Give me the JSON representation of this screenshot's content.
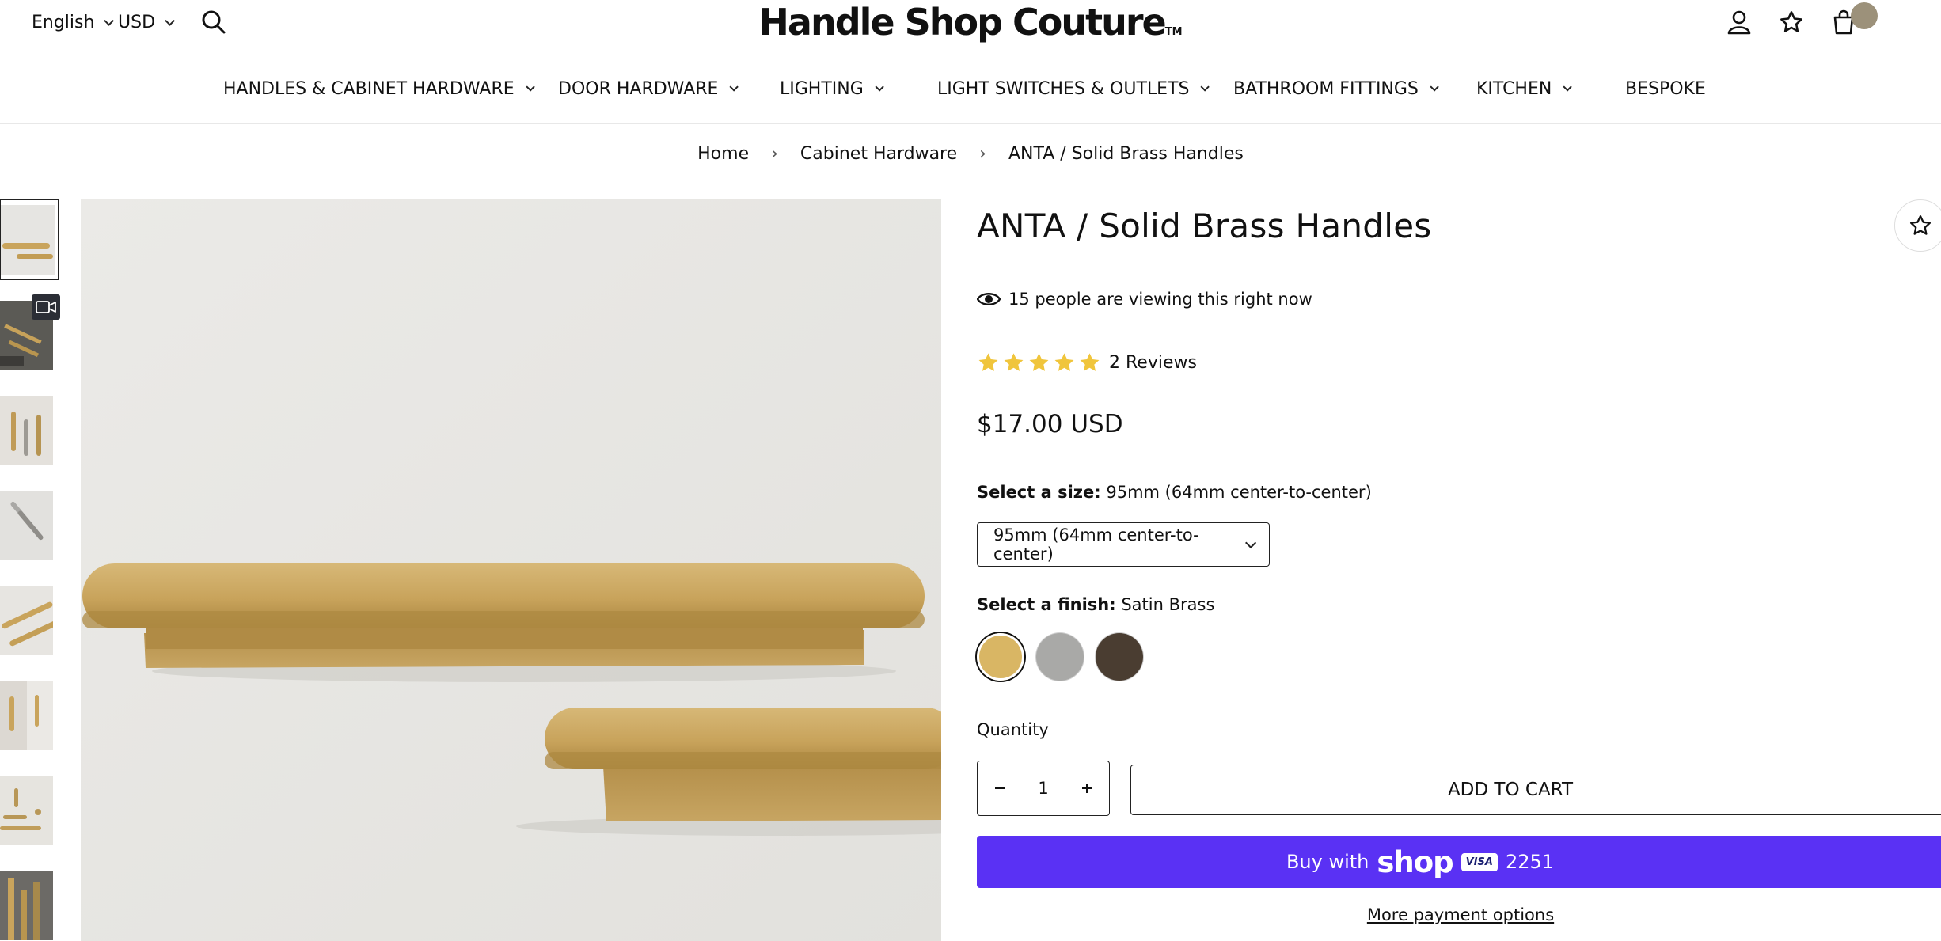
{
  "header": {
    "language": "English",
    "currency": "USD",
    "logo_text": "Handle Shop Couture",
    "logo_tm": "TM"
  },
  "nav": {
    "items": [
      {
        "label": "HANDLES & CABINET HARDWARE",
        "has_dropdown": true
      },
      {
        "label": "DOOR HARDWARE",
        "has_dropdown": true
      },
      {
        "label": "LIGHTING",
        "has_dropdown": true
      },
      {
        "label": "LIGHT SWITCHES & OUTLETS",
        "has_dropdown": true
      },
      {
        "label": "BATHROOM FITTINGS",
        "has_dropdown": true
      },
      {
        "label": "KITCHEN",
        "has_dropdown": true
      },
      {
        "label": "BESPOKE",
        "has_dropdown": false
      }
    ]
  },
  "breadcrumb": [
    "Home",
    "Cabinet Hardware",
    "ANTA / Solid Brass Handles"
  ],
  "product": {
    "title": "ANTA / Solid Brass Handles",
    "viewers_text": "15 people are viewing this right now",
    "rating_stars": 5,
    "reviews_text": "2 Reviews",
    "price": "$17.00 USD",
    "size_label": "Select a size:",
    "size_value": "95mm (64mm center-to-center)",
    "size_selected": "95mm (64mm center-to-center)",
    "finish_label": "Select a finish:",
    "finish_value": "Satin Brass",
    "finishes": [
      {
        "color": "#d9b664",
        "selected": true
      },
      {
        "color": "#a9a9a7",
        "selected": false
      },
      {
        "color": "#4a3d31",
        "selected": false
      }
    ],
    "quantity_label": "Quantity",
    "quantity": "1",
    "add_to_cart": "ADD TO CART",
    "buy_with": "Buy with",
    "shop_word": "shop",
    "card_brand": "VISA",
    "card_last4": "2251",
    "more_payment": "More payment options"
  },
  "colors": {
    "shop_pay": "#5a31f4",
    "star": "#f0c53c",
    "brass": "#c8a45a"
  }
}
